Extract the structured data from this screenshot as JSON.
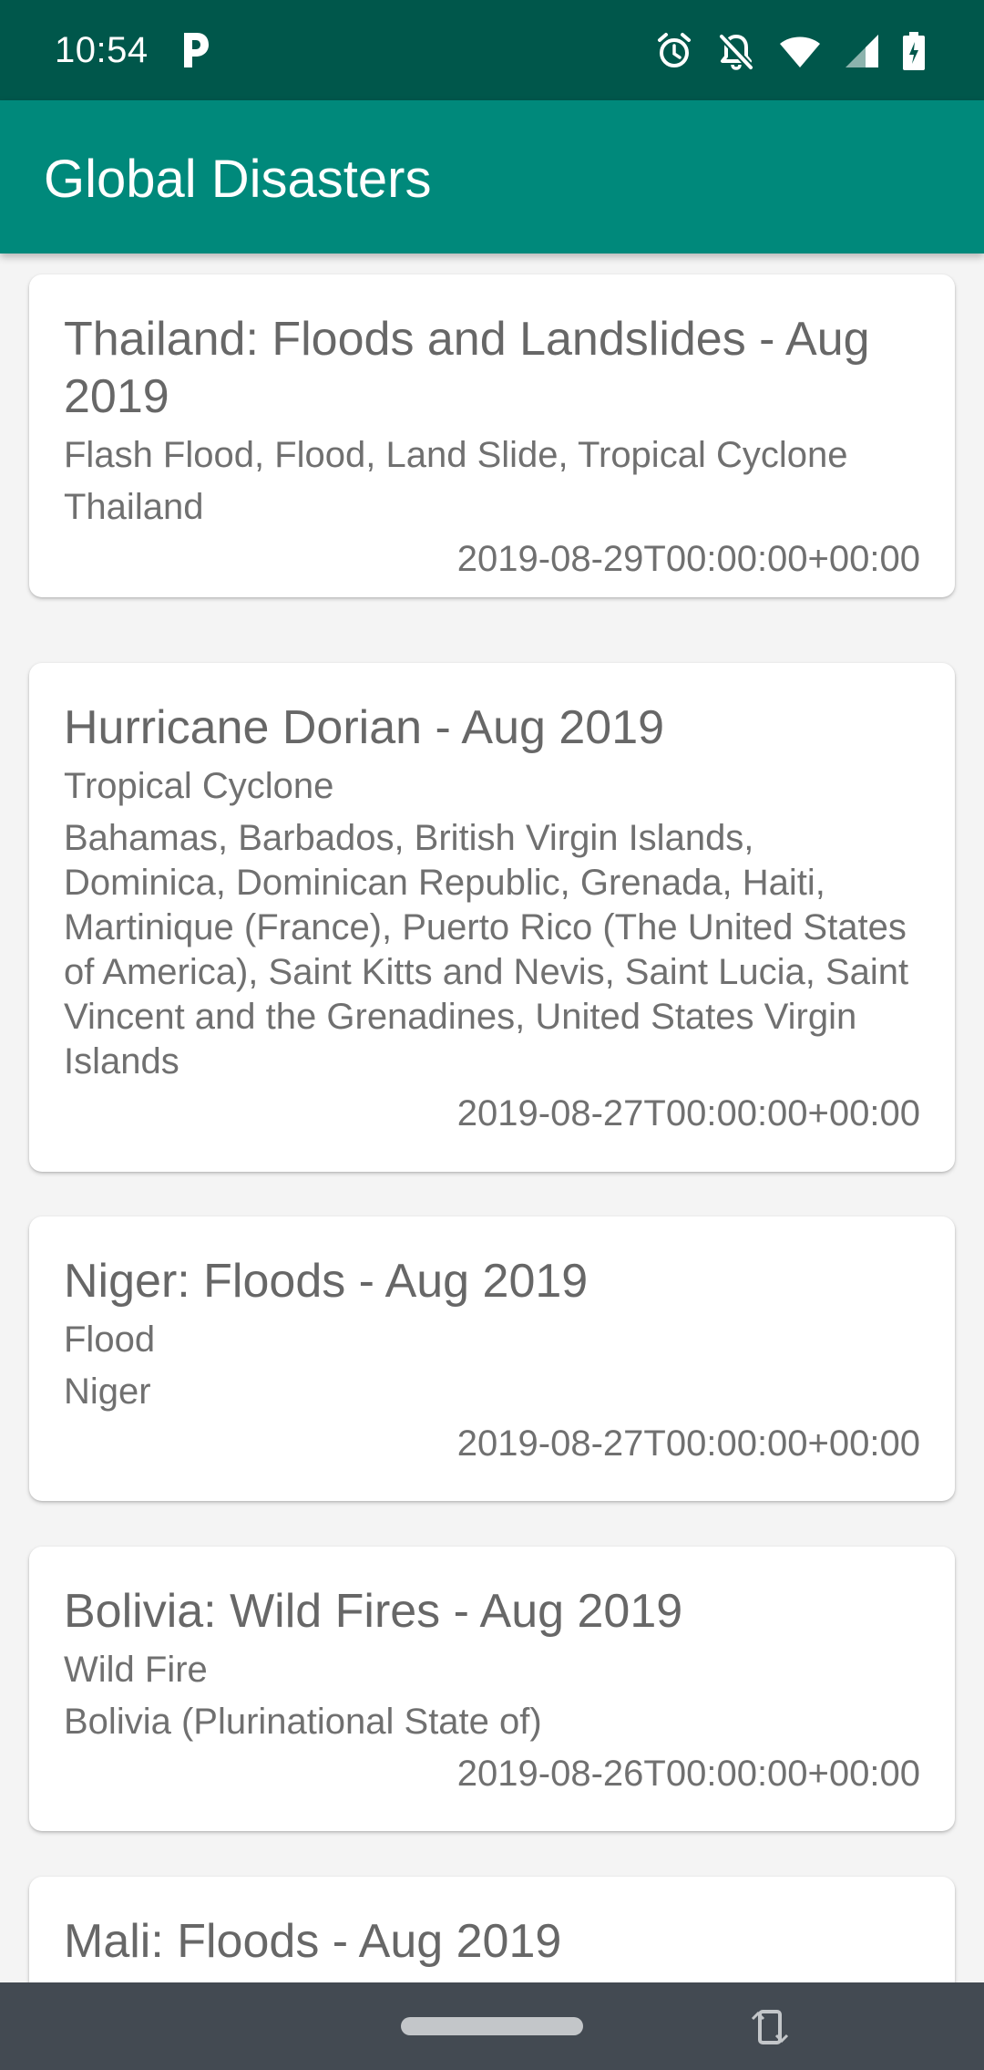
{
  "status_bar": {
    "time": "10:54",
    "icons": [
      "parking-icon",
      "alarm-icon",
      "notifications-off-icon",
      "wifi-icon",
      "cell-signal-icon",
      "battery-icon"
    ]
  },
  "app_bar": {
    "title": "Global Disasters"
  },
  "disasters": [
    {
      "title": "Thailand: Floods and Landslides - Aug 2019",
      "types": "Flash Flood, Flood, Land Slide, Tropical Cyclone",
      "countries": "Thailand",
      "date": "2019-08-29T00:00:00+00:00"
    },
    {
      "title": "Hurricane Dorian - Aug 2019",
      "types": "Tropical Cyclone",
      "countries": "Bahamas, Barbados, British Virgin Islands, Dominica, Dominican Republic, Grenada, Haiti, Martinique (France), Puerto Rico (The United States of America), Saint Kitts and Nevis, Saint Lucia, Saint Vincent and the Grenadines, United States Virgin Islands",
      "date": "2019-08-27T00:00:00+00:00"
    },
    {
      "title": "Niger: Floods - Aug 2019",
      "types": "Flood",
      "countries": "Niger",
      "date": "2019-08-27T00:00:00+00:00"
    },
    {
      "title": "Bolivia: Wild Fires - Aug 2019",
      "types": "Wild Fire",
      "countries": "Bolivia (Plurinational State of)",
      "date": "2019-08-26T00:00:00+00:00"
    },
    {
      "title": "Mali: Floods - Aug 2019",
      "types": "",
      "countries": "",
      "date": ""
    }
  ],
  "colors": {
    "status_bar": "#00574b",
    "app_bar": "#00897b",
    "background": "#f4f4f4",
    "nav_bar": "#434a52"
  }
}
